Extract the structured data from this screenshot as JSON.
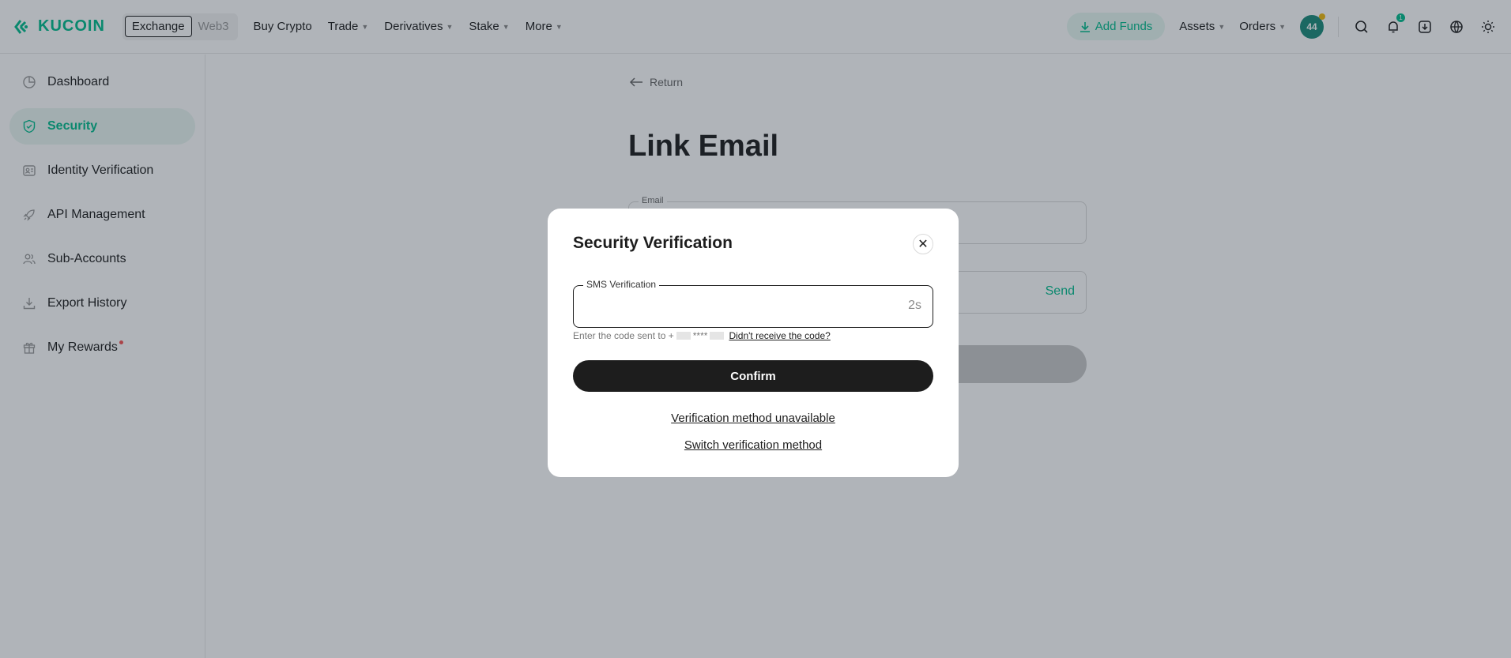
{
  "header": {
    "logo_text": "KUCOIN",
    "seg": [
      "Exchange",
      "Web3"
    ],
    "nav": [
      {
        "label": "Buy Crypto",
        "caret": false
      },
      {
        "label": "Trade",
        "caret": true
      },
      {
        "label": "Derivatives",
        "caret": true
      },
      {
        "label": "Stake",
        "caret": true
      },
      {
        "label": "More",
        "caret": true
      }
    ],
    "add_funds": "Add Funds",
    "assets": "Assets",
    "orders": "Orders",
    "avatar": "44",
    "notif_count": "1"
  },
  "sidebar": {
    "items": [
      {
        "label": "Dashboard",
        "icon": "dashboard-icon"
      },
      {
        "label": "Security",
        "icon": "shield-icon",
        "active": true
      },
      {
        "label": "Identity Verification",
        "icon": "id-card-icon"
      },
      {
        "label": "API Management",
        "icon": "rocket-icon"
      },
      {
        "label": "Sub-Accounts",
        "icon": "users-icon"
      },
      {
        "label": "Export History",
        "icon": "download-icon"
      },
      {
        "label": "My Rewards",
        "icon": "gift-icon"
      }
    ]
  },
  "main": {
    "return_label": "Return",
    "title": "Link Email",
    "email_label": "Email",
    "send_label": "Send"
  },
  "modal": {
    "title": "Security Verification",
    "sms_label": "SMS Verification",
    "timer": "2s",
    "hint_prefix": "Enter the code sent to +",
    "hint_masked": "****",
    "hint_link": "Didn't receive the code?",
    "confirm": "Confirm",
    "unavailable": "Verification method unavailable",
    "switch": "Switch verification method"
  },
  "colors": {
    "brand": "#01bc8d",
    "dark": "#1d1d1d"
  }
}
